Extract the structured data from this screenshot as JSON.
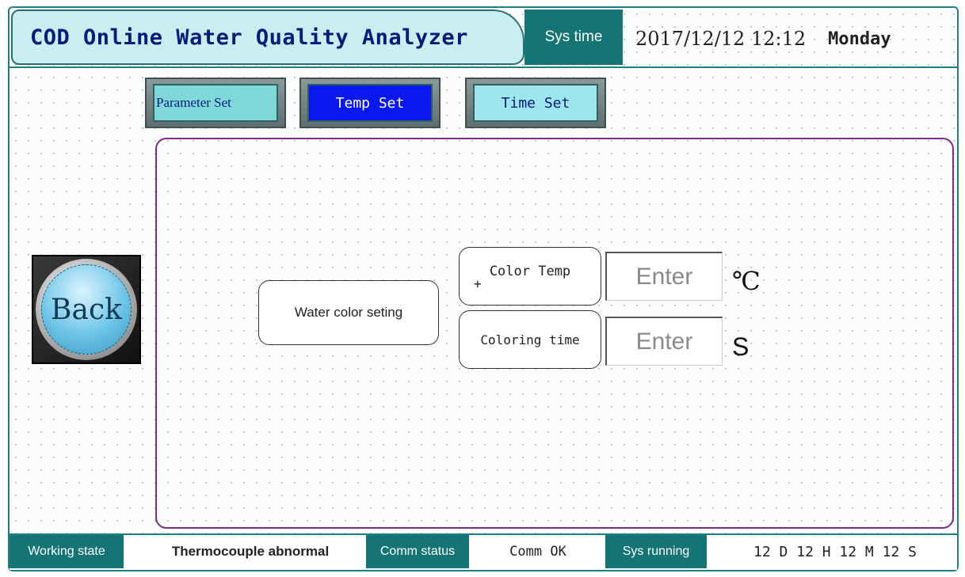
{
  "header": {
    "title": "COD Online Water Quality Analyzer",
    "sys_time_label": "Sys time",
    "date_time": "2017/12/12 12:12",
    "weekday": "Monday"
  },
  "tabs": {
    "parameter_set": "Parameter Set",
    "temp_set": "Temp Set",
    "time_set": "Time Set"
  },
  "back_button": "Back",
  "settings": {
    "group_label": "Water color seting",
    "color_temp_label": "Color Temp",
    "color_temp_symbol": "+",
    "color_temp_placeholder": "Enter",
    "color_temp_unit": "℃",
    "coloring_time_label": "Coloring time",
    "coloring_time_placeholder": "Enter",
    "coloring_time_unit": "S"
  },
  "status_bar": {
    "working_state_label": "Working state",
    "working_state_value": "Thermocouple abnormal",
    "comm_status_label": "Comm status",
    "comm_status_value": "Comm OK",
    "sys_running_label": "Sys running",
    "sys_running_value": "12 D 12 H 12 M 12 S"
  },
  "colors": {
    "teal": "#157575",
    "active_tab": "#0a18ee",
    "title_bg": "#c8eef0",
    "panel_border": "#7a2a8a"
  }
}
